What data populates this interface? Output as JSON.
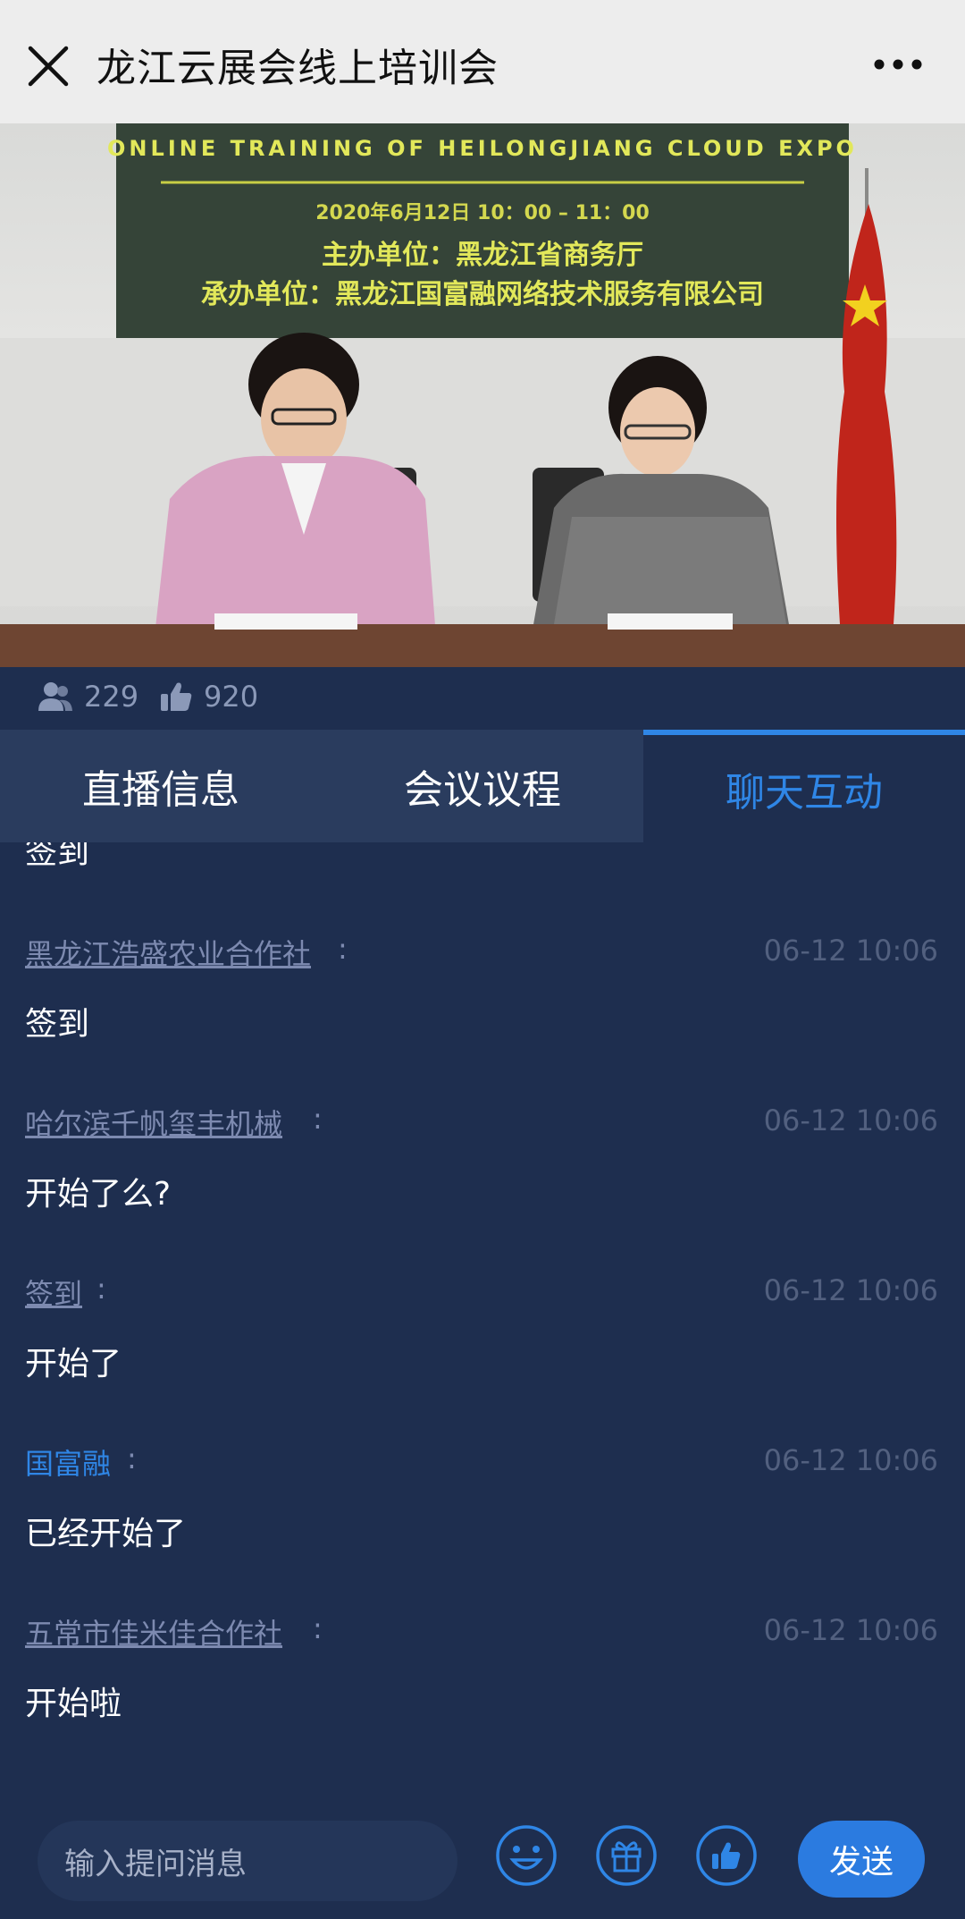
{
  "header": {
    "title": "龙江云展会线上培训会"
  },
  "video": {
    "banner_en": "ONLINE TRAINING OF HEILONGJIANG CLOUD EXPO",
    "banner_date": "2020年6月12日 10：00 – 11：00",
    "banner_host": "主办单位：黑龙江省商务厅",
    "banner_org": "承办单位：黑龙江国富融网络技术服务有限公司"
  },
  "stats": {
    "viewers": "229",
    "likes": "920"
  },
  "tabs": [
    {
      "label": "直播信息"
    },
    {
      "label": "会议议程"
    },
    {
      "label": "聊天互动"
    }
  ],
  "chat": {
    "partial_text": "签到",
    "messages": [
      {
        "user": "黑龙江浩盛农业合作社",
        "time": "06-12 10:06",
        "text": "签到"
      },
      {
        "user": "哈尔滨千帆玺丰机械",
        "time": "06-12 10:06",
        "text": "开始了么?"
      },
      {
        "user": "签到",
        "time": "06-12 10:06",
        "text": "开始了"
      },
      {
        "user": "国富融",
        "time": "06-12 10:06",
        "text": "已经开始了"
      },
      {
        "user": "五常市佳米佳合作社",
        "time": "06-12 10:06",
        "text": "开始啦"
      }
    ]
  },
  "input": {
    "placeholder": "输入提问消息",
    "send_label": "发送"
  },
  "colors": {
    "accent": "#2f86e6",
    "background": "#1e2e4f"
  }
}
